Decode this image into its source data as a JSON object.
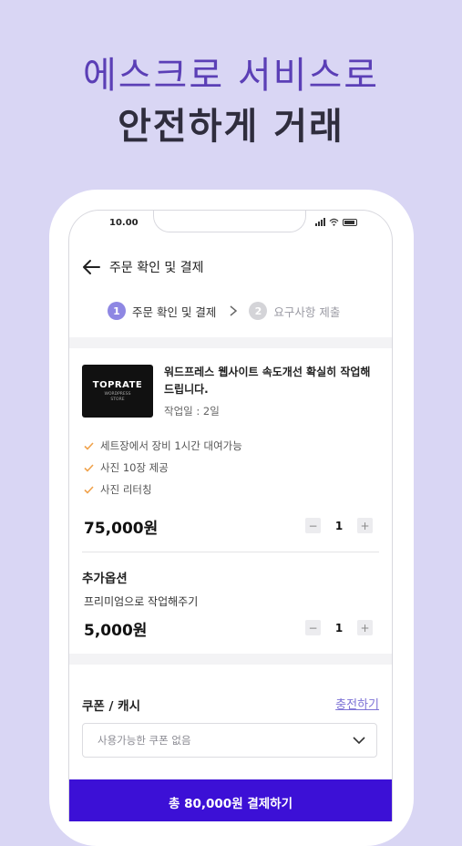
{
  "hero": {
    "line1": "에스크로 서비스로",
    "line2": "안전하게 거래"
  },
  "status_bar": {
    "time": "10.00"
  },
  "header": {
    "title": "주문 확인 및 결제"
  },
  "steps": [
    {
      "num": "1",
      "label": "주문 확인 및 결제"
    },
    {
      "num": "2",
      "label": "요구사항 제출"
    }
  ],
  "product": {
    "thumb_brand": "TOPRATE",
    "thumb_sub": "WORDPRESS\nSTORE",
    "title": "워드프레스 웹사이트 속도개선 확실히 작업해 드립니다.",
    "meta": "작업일 : 2일",
    "features": [
      "세트장에서 장비 1시간 대여가능",
      "사진 10장 제공",
      "사진 리터칭"
    ],
    "price": "75,000원",
    "quantity": "1"
  },
  "options": {
    "heading": "추가옵션",
    "name": "프리미엄으로 작업해주기",
    "price": "5,000원",
    "quantity": "1"
  },
  "coupon": {
    "heading": "쿠폰 / 캐시",
    "charge_link": "충전하기",
    "select_value": "사용가능한 쿠폰 없음"
  },
  "pay_button": "총 80,000원 결제하기",
  "stepper": {
    "minus": "−",
    "plus": "+"
  },
  "colors": {
    "accent": "#3c10d6",
    "hero": "#5b3fb6",
    "background": "#d9d6f4"
  }
}
